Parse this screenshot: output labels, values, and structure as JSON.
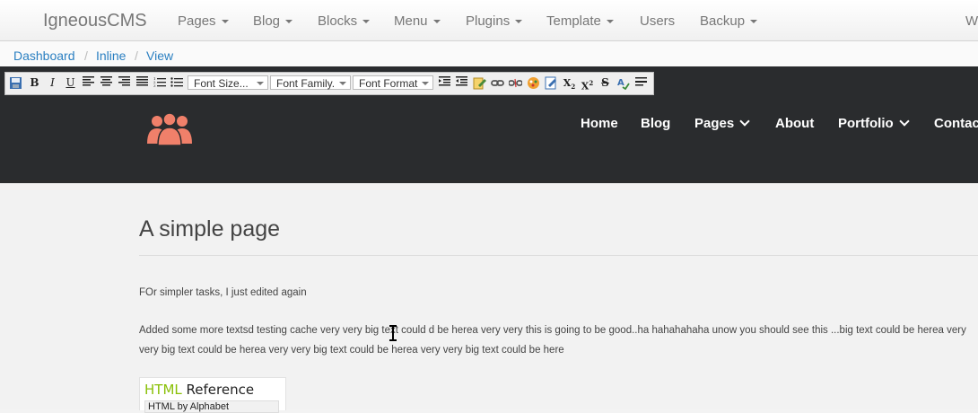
{
  "topnav": {
    "brand": "IgneousCMS",
    "items": [
      {
        "label": "Pages"
      },
      {
        "label": "Blog"
      },
      {
        "label": "Blocks"
      },
      {
        "label": "Menu"
      },
      {
        "label": "Plugins"
      },
      {
        "label": "Template"
      },
      {
        "label": "Users"
      },
      {
        "label": "Backup"
      }
    ],
    "edge_text": "W"
  },
  "breadcrumb": [
    "Dashboard",
    "Inline",
    "View"
  ],
  "toolbar": {
    "font_size_placeholder": "Font Size...",
    "font_family_placeholder": "Font Family.",
    "font_format_placeholder": "Font Format",
    "buttons": [
      "save-icon",
      "bold",
      "italic",
      "underline",
      "align-left",
      "align-center",
      "align-right",
      "align-justify",
      "ordered-list",
      "unordered-list",
      "indent",
      "outdent",
      "edit",
      "link",
      "unlink",
      "image",
      "emoticon",
      "color",
      "subscript",
      "superscript",
      "strikethrough",
      "spellcheck",
      "horizontal-rule"
    ]
  },
  "site": {
    "nav": [
      "Home",
      "Blog",
      "Pages",
      "About",
      "Portfolio",
      "Contac"
    ],
    "logo_color": "#f0806a"
  },
  "page": {
    "title": "A simple page",
    "para1": "FOr simpler tasks, I just edited again",
    "para2": "Added some more textsd testing cache very very big text could d be herea very very this is going to be good..ha hahahahaha unow you should see this ...big text could be herea very very big text could be herea very very big text could be herea very very big text could be here",
    "ref_prefix": "HTML",
    "ref_suffix": " Reference",
    "ref_sub": "HTML by Alphabet"
  }
}
